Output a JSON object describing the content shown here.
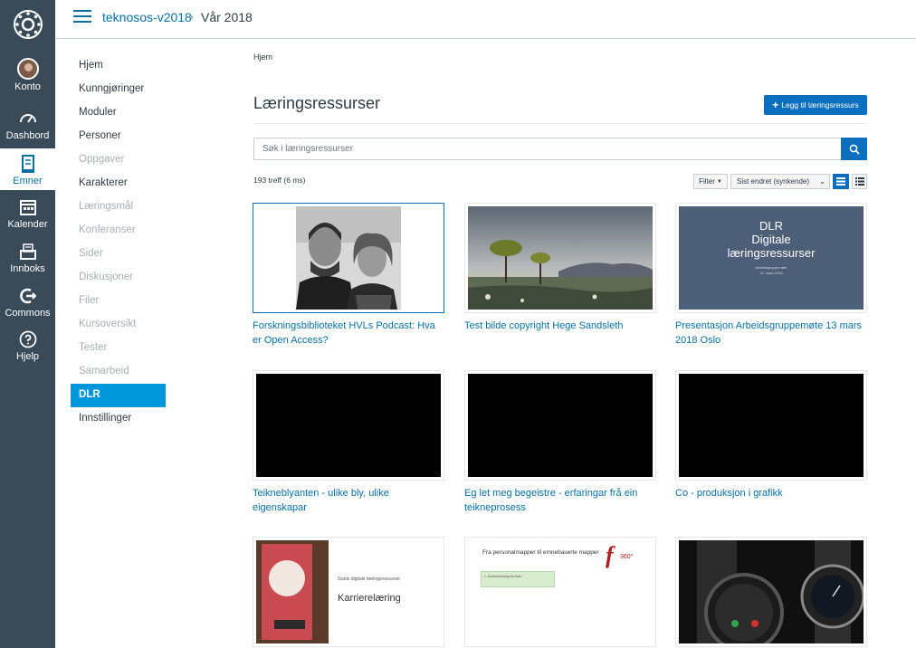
{
  "global_nav": {
    "items": [
      {
        "label": "Konto",
        "icon": "account-avatar"
      },
      {
        "label": "Dashbord",
        "icon": "dashboard-icon"
      },
      {
        "label": "Emner",
        "icon": "courses-icon",
        "active": true
      },
      {
        "label": "Kalender",
        "icon": "calendar-icon"
      },
      {
        "label": "Innboks",
        "icon": "inbox-icon"
      },
      {
        "label": "Commons",
        "icon": "commons-icon"
      },
      {
        "label": "Hjelp",
        "icon": "help-icon"
      }
    ]
  },
  "header": {
    "course": "teknosos-v2018",
    "separator": "›",
    "term": "Vår 2018"
  },
  "course_nav": [
    {
      "label": "Hjem",
      "state": "enabled"
    },
    {
      "label": "Kunngjøringer",
      "state": "enabled"
    },
    {
      "label": "Moduler",
      "state": "enabled"
    },
    {
      "label": "Personer",
      "state": "enabled"
    },
    {
      "label": "Oppgaver",
      "state": "disabled"
    },
    {
      "label": "Karakterer",
      "state": "enabled"
    },
    {
      "label": "Læringsmål",
      "state": "disabled"
    },
    {
      "label": "Konferanser",
      "state": "disabled"
    },
    {
      "label": "Sider",
      "state": "disabled"
    },
    {
      "label": "Diskusjoner",
      "state": "disabled"
    },
    {
      "label": "Filer",
      "state": "disabled"
    },
    {
      "label": "Kursoversikt",
      "state": "disabled"
    },
    {
      "label": "Tester",
      "state": "disabled"
    },
    {
      "label": "Samarbeid",
      "state": "disabled"
    },
    {
      "label": "DLR",
      "state": "active"
    },
    {
      "label": "Innstillinger",
      "state": "enabled"
    }
  ],
  "main": {
    "breadcrumb": "Hjem",
    "title": "Læringsressurser",
    "add_button": "Legg til læringsressurs",
    "search_placeholder": "Søk i læringsressurser",
    "hits": "193 treff (6 ms)",
    "filter_label": "Filter",
    "sort_label": "Sist endret (synkende)",
    "colors": {
      "accent": "#0a6fbf",
      "nav_bg": "#394b58",
      "active_nav": "#0096db",
      "link": "#0770a3"
    },
    "cards": [
      {
        "caption": "Forskningsbiblioteket HVLs Podcast: Hva er Open Access?",
        "thumb": "photo-two-people"
      },
      {
        "caption": "Test bilde copyright Hege Sandsleth",
        "thumb": "photo-landscape-trees"
      },
      {
        "caption": "Presentasjon Arbeidsgruppemøte 13 mars 2018 Oslo",
        "thumb": "slide-dlr",
        "slide": {
          "l1": "DLR",
          "l2": "Digitale",
          "l3": "læringsressurser",
          "small1": "arbeidsgruppemøte",
          "small2": "13. mars 2018"
        }
      },
      {
        "caption": "Teikneblyanten - ulike bly, ulike eigenskapar",
        "thumb": "video-black"
      },
      {
        "caption": "Eg let meg begeistre - erfaringar frå ein teikneprosess",
        "thumb": "video-black"
      },
      {
        "caption": "Co - produksjon i grafikk",
        "thumb": "video-black"
      },
      {
        "caption": "",
        "thumb": "slide-karrierelaering",
        "slide": {
          "title": "Karrierelæring",
          "sub": "Gratis digitale læringsressurser"
        }
      },
      {
        "caption": "",
        "thumb": "slide-personalmapper",
        "slide": {
          "title": "Fra personalmapper til emnebaserte mapper",
          "brand": "360°",
          "box": "1. Endrearbeiding fra team"
        }
      },
      {
        "caption": "",
        "thumb": "photo-smartwatch"
      }
    ]
  }
}
